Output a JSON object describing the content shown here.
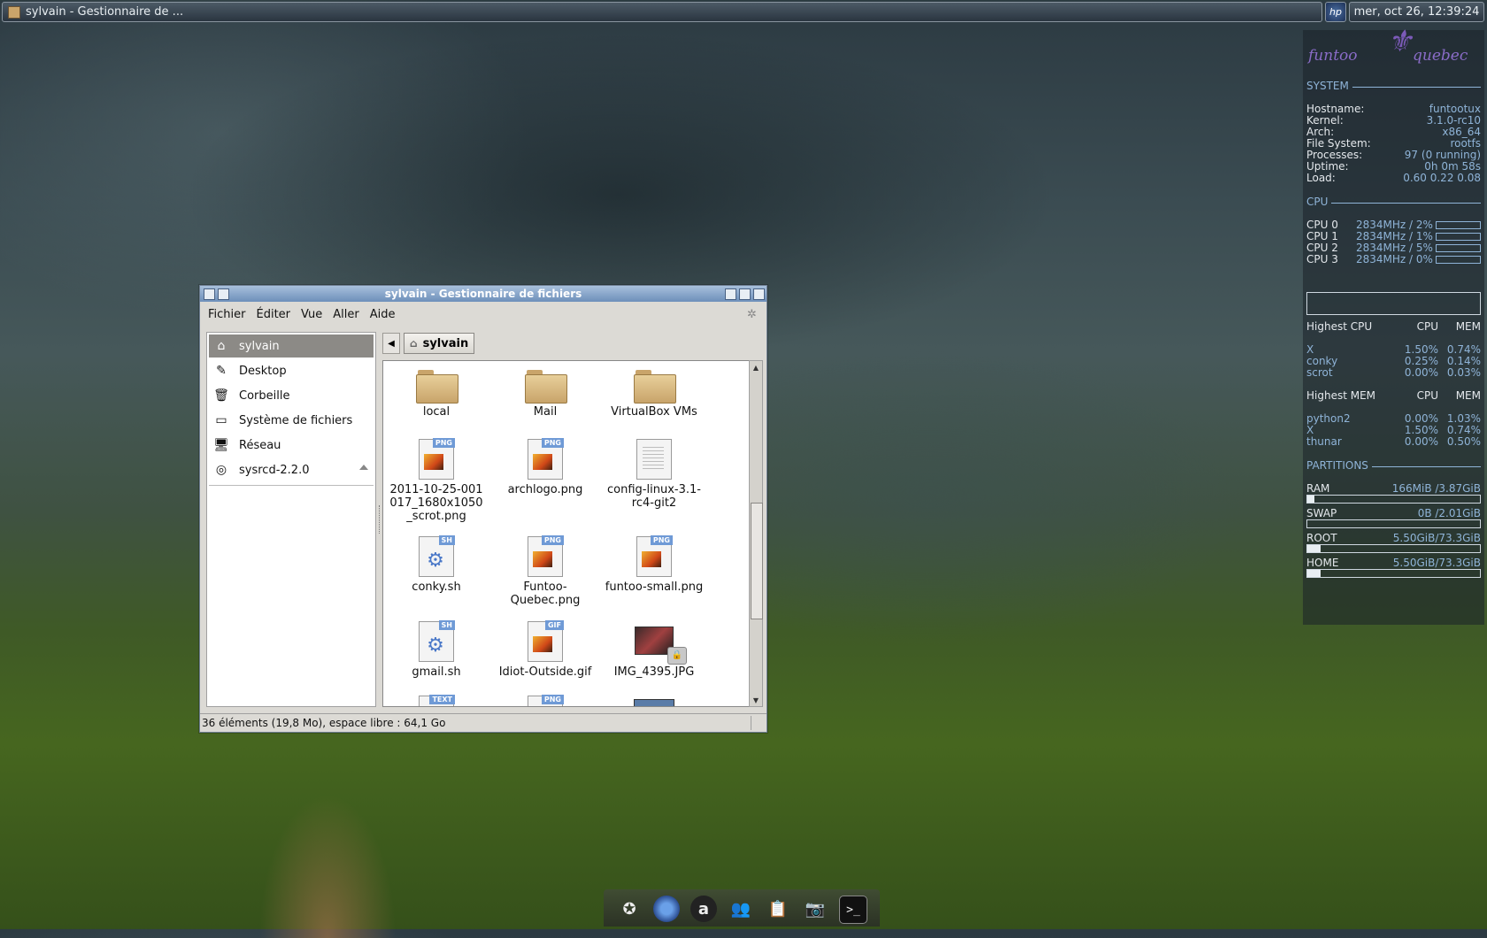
{
  "taskbar": {
    "window_button_label": "sylvain - Gestionnaire de ...",
    "hp_label": "hp",
    "clock": "mer, oct 26, 12:39:24"
  },
  "conky": {
    "logo_left": "funtoo",
    "logo_right": "quebec",
    "system_title": "SYSTEM",
    "system": [
      {
        "k": "Hostname:",
        "v": "funtootux"
      },
      {
        "k": "Kernel:",
        "v": "3.1.0-rc10"
      },
      {
        "k": "Arch:",
        "v": "x86_64"
      },
      {
        "k": "File System:",
        "v": "rootfs"
      },
      {
        "k": "Processes:",
        "v": "97  (0   running)"
      },
      {
        "k": "Uptime:",
        "v": "0h 0m 58s"
      },
      {
        "k": "Load:",
        "v": "0.60 0.22 0.08"
      }
    ],
    "cpu_title": "CPU",
    "cpus": [
      {
        "k": "CPU 0",
        "v": "2834MHz / 2%"
      },
      {
        "k": "CPU 1",
        "v": "2834MHz / 1%"
      },
      {
        "k": "CPU 2",
        "v": "2834MHz / 5%"
      },
      {
        "k": "CPU 3",
        "v": "2834MHz / 0%"
      }
    ],
    "cpu_usage_percent": [
      2,
      1,
      5,
      0
    ],
    "highest_cpu_header": {
      "name": "Highest CPU",
      "cpu": "CPU",
      "mem": "MEM"
    },
    "highest_cpu": [
      {
        "n": "X",
        "c": "1.50%",
        "m": "0.74%"
      },
      {
        "n": "conky",
        "c": "0.25%",
        "m": "0.14%"
      },
      {
        "n": "scrot",
        "c": "0.00%",
        "m": "0.03%"
      }
    ],
    "highest_mem_header": {
      "name": "Highest MEM",
      "cpu": "CPU",
      "mem": "MEM"
    },
    "highest_mem": [
      {
        "n": "python2",
        "c": "0.00%",
        "m": "1.03%"
      },
      {
        "n": "X",
        "c": "1.50%",
        "m": "0.74%"
      },
      {
        "n": "thunar",
        "c": "0.00%",
        "m": "0.50%"
      }
    ],
    "partitions_title": "PARTITIONS",
    "partitions": [
      {
        "k": "RAM",
        "v": "166MiB /3.87GiB",
        "fill": 0.04
      },
      {
        "k": "SWAP",
        "v": "0B  /2.01GiB",
        "fill": 0.0
      },
      {
        "k": "ROOT",
        "v": "5.50GiB/73.3GiB",
        "fill": 0.075
      },
      {
        "k": "HOME",
        "v": "5.50GiB/73.3GiB",
        "fill": 0.075
      }
    ]
  },
  "window": {
    "title": "sylvain - Gestionnaire de fichiers",
    "menu": [
      "Fichier",
      "Éditer",
      "Vue",
      "Aller",
      "Aide"
    ],
    "sidebar": [
      {
        "label": "sylvain",
        "icon": "home-icon",
        "selected": true
      },
      {
        "label": "Desktop",
        "icon": "desktop-icon"
      },
      {
        "label": "Corbeille",
        "icon": "trash-icon"
      },
      {
        "label": "Système de fichiers",
        "icon": "drive-icon"
      },
      {
        "label": "Réseau",
        "icon": "network-icon"
      },
      {
        "label": "sysrcd-2.2.0",
        "icon": "disc-icon"
      }
    ],
    "path_crumb": "sylvain",
    "files": [
      {
        "name": "local",
        "type": "folder"
      },
      {
        "name": "Mail",
        "type": "folder"
      },
      {
        "name": "VirtualBox VMs",
        "type": "folder"
      },
      {
        "name": "2011-10-25-001017_1680x1050_scrot.png",
        "type": "png",
        "badge": "PNG"
      },
      {
        "name": "archlogo.png",
        "type": "png",
        "badge": "PNG"
      },
      {
        "name": "config-linux-3.1-rc4-git2",
        "type": "text"
      },
      {
        "name": "conky.sh",
        "type": "sh",
        "badge": "SH"
      },
      {
        "name": "Funtoo-Quebec.png",
        "type": "png",
        "badge": "PNG"
      },
      {
        "name": "funtoo-small.png",
        "type": "png",
        "badge": "PNG"
      },
      {
        "name": "gmail.sh",
        "type": "sh",
        "badge": "SH"
      },
      {
        "name": "Idiot-Outside.gif",
        "type": "gif",
        "badge": "GIF"
      },
      {
        "name": "IMG_4395.JPG",
        "type": "jpg"
      }
    ],
    "partial_badges": [
      "TEXT",
      "PNG"
    ],
    "status": "36 éléments (19,8 Mo), espace libre : 64,1 Go"
  },
  "dock": [
    "app-icon",
    "chromium-icon",
    "amarok-icon",
    "users-icon",
    "clipboard-icon",
    "screenshot-icon",
    "terminal-icon"
  ]
}
